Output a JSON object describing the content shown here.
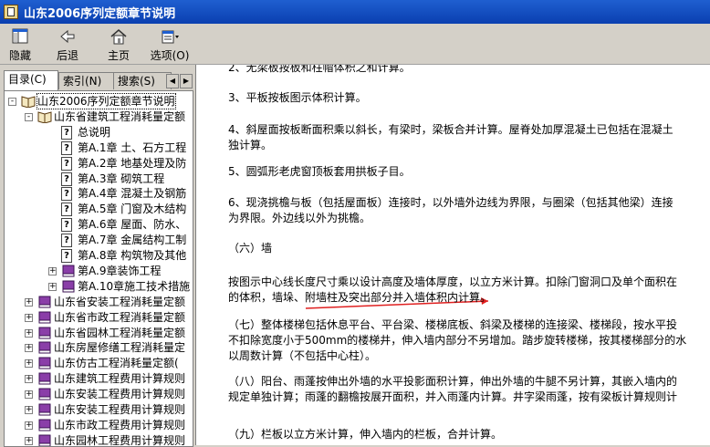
{
  "window": {
    "title": "山东2006序列定额章节说明"
  },
  "toolbar": [
    {
      "label": "隐藏",
      "icon": "hide-pane-icon"
    },
    {
      "label": "后退",
      "icon": "back-arrow-icon"
    },
    {
      "label": "主页",
      "icon": "home-icon"
    },
    {
      "label": "选项(O)",
      "icon": "options-icon"
    }
  ],
  "tabs": [
    {
      "label": "目录(C)"
    },
    {
      "label": "索引(N)"
    },
    {
      "label": "搜索(S)"
    }
  ],
  "tree": [
    {
      "label": "山东2006序列定额章节说明",
      "level": 0,
      "type": "book-open",
      "expander": "-"
    },
    {
      "label": "山东省建筑工程消耗量定额",
      "level": 1,
      "type": "book-open",
      "expander": "-"
    },
    {
      "label": "总说明",
      "level": 2,
      "type": "page"
    },
    {
      "label": "第A.1章  土、石方工程",
      "level": 2,
      "type": "page"
    },
    {
      "label": "第A.2章  地基处理及防",
      "level": 2,
      "type": "page"
    },
    {
      "label": "第A.3章  砌筑工程",
      "level": 2,
      "type": "page"
    },
    {
      "label": "第A.4章  混凝土及钢筋",
      "level": 2,
      "type": "page"
    },
    {
      "label": "第A.5章  门窗及木结构",
      "level": 2,
      "type": "page"
    },
    {
      "label": "第A.6章  屋面、防水、",
      "level": 2,
      "type": "page"
    },
    {
      "label": "第A.7章  金属结构工制",
      "level": 2,
      "type": "page"
    },
    {
      "label": "第A.8章  构筑物及其他",
      "level": 2,
      "type": "page"
    },
    {
      "label": "第A.9章装饰工程",
      "level": 2,
      "type": "book",
      "expander": "+"
    },
    {
      "label": "第A.10章施工技术措施",
      "level": 2,
      "type": "book",
      "expander": "+"
    },
    {
      "label": "山东省安装工程消耗量定额",
      "level": 1,
      "type": "book",
      "expander": "+"
    },
    {
      "label": "山东省市政工程消耗量定额",
      "level": 1,
      "type": "book",
      "expander": "+"
    },
    {
      "label": "山东省园林工程消耗量定额",
      "level": 1,
      "type": "book",
      "expander": "+"
    },
    {
      "label": "山东房屋修缮工程消耗量定",
      "level": 1,
      "type": "book",
      "expander": "+"
    },
    {
      "label": "山东仿古工程消耗量定额(",
      "level": 1,
      "type": "book",
      "expander": "+"
    },
    {
      "label": "山东建筑工程费用计算规则",
      "level": 1,
      "type": "book",
      "expander": "+"
    },
    {
      "label": "山东安装工程费用计算规则",
      "level": 1,
      "type": "book",
      "expander": "+"
    },
    {
      "label": "山东安装工程费用计算规则",
      "level": 1,
      "type": "book",
      "expander": "+"
    },
    {
      "label": "山东市政工程费用计算规则",
      "level": 1,
      "type": "book",
      "expander": "+"
    },
    {
      "label": "山东园林工程费用计算规则",
      "level": 1,
      "type": "book",
      "expander": "+"
    }
  ],
  "content": {
    "paragraphs": [
      [
        "2、无梁板按板和柱帽体积之和计算。"
      ],
      [
        "3、平板按板图示体积计算。"
      ],
      [
        "4、斜屋面按板断面积乘以斜长，有梁时，梁板合并计算。屋脊处加厚混凝土已包括在混凝土",
        "独计算。"
      ],
      [
        "5、圆弧形老虎窗顶板套用拱板子目。"
      ],
      [
        "6、现浇挑檐与板（包括屋面板）连接时，以外墙外边线为界限，与圈梁（包括其他梁）连接",
        "为界限。外边线以外为挑檐。"
      ],
      [
        "（六）墙"
      ],
      [
        "按图示中心线长度尺寸乘以设计高度及墙体厚度，以立方米计算。扣除门窗洞口及单个面积在",
        "的体积，墙垛、附墙柱及突出部分并入墙体积内计算。"
      ],
      [
        "（七）整体楼梯包括休息平台、平台梁、楼梯底板、斜梁及楼梯的连接梁、楼梯段，按水平投",
        "不扣除宽度小于500mm的楼梯井，伸入墙内部分不另增加。踏步旋转楼梯，按其楼梯部分的水",
        "以周数计算（不包括中心柱）。"
      ],
      [
        "（八）阳台、雨蓬按伸出外墙的水平投影面积计算，伸出外墙的牛腿不另计算，其嵌入墙内的",
        "规定单独计算；雨蓬的翻檐按展开面积，并入雨蓬内计算。井字梁雨蓬，按有梁板计算规则计"
      ],
      [
        "（九）栏板以立方米计算，伸入墙内的栏板，合并计算。"
      ]
    ]
  },
  "colors": {
    "titlebar": "#0a3fb0",
    "window_bg": "#d4d0c8",
    "annotation": "#e02020"
  }
}
